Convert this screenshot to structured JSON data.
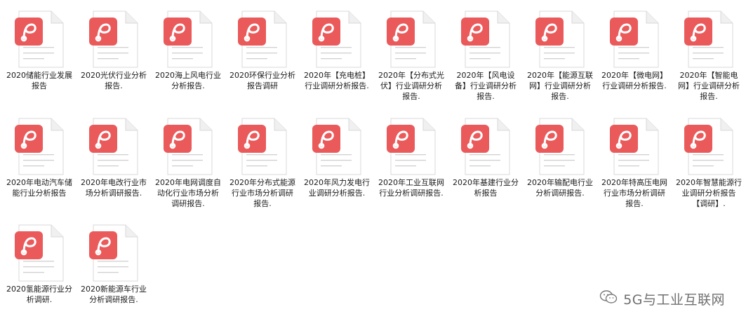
{
  "files": [
    "2020储能行业发展报告",
    "2020光伏行业分析报告.",
    "2020海上风电行业分析报告.",
    "2020环保行业分析报告调研",
    "2020年【充电桩】行业调研分析报告.",
    "2020年【分布式光伏】行业调研分析报告.",
    "2020年【风电设备】行业调研分析报告.",
    "2020年【能源互联网】行业调研分析报告.",
    "2020年【微电网】行业调研分析报告.",
    "2020年【智能电网】行业调研分析报告.",
    "2020年电动汽车储能行业分析报告",
    "2020年电改行业市场分析调研报告.",
    "2020年电网调度自动化行业市场分析调研报告.",
    "2020年分布式能源行业市场分析调研报告.",
    "2020年风力发电行业调研分析报告.",
    "2020年工业互联网行业分析调研报告.",
    "2020年基建行业分析报告",
    "2020年输配电行业分析调研报告.",
    "2020年特高压电网行业市场分析调研报告.",
    "2020年智慧能源行业调研分析报告【调研】.",
    "2020氢能源行业分析调研.",
    "2020新能源车行业分析调研报告."
  ],
  "icon": {
    "name": "pdf-file-icon",
    "badge_color": "#ea5a5b",
    "paper_color": "#ffffff",
    "border_color": "#d8d8d8",
    "line_color": "#d0d0d0"
  },
  "watermark": {
    "text": "5G与工业互联网",
    "logo": "wechat-icon"
  }
}
